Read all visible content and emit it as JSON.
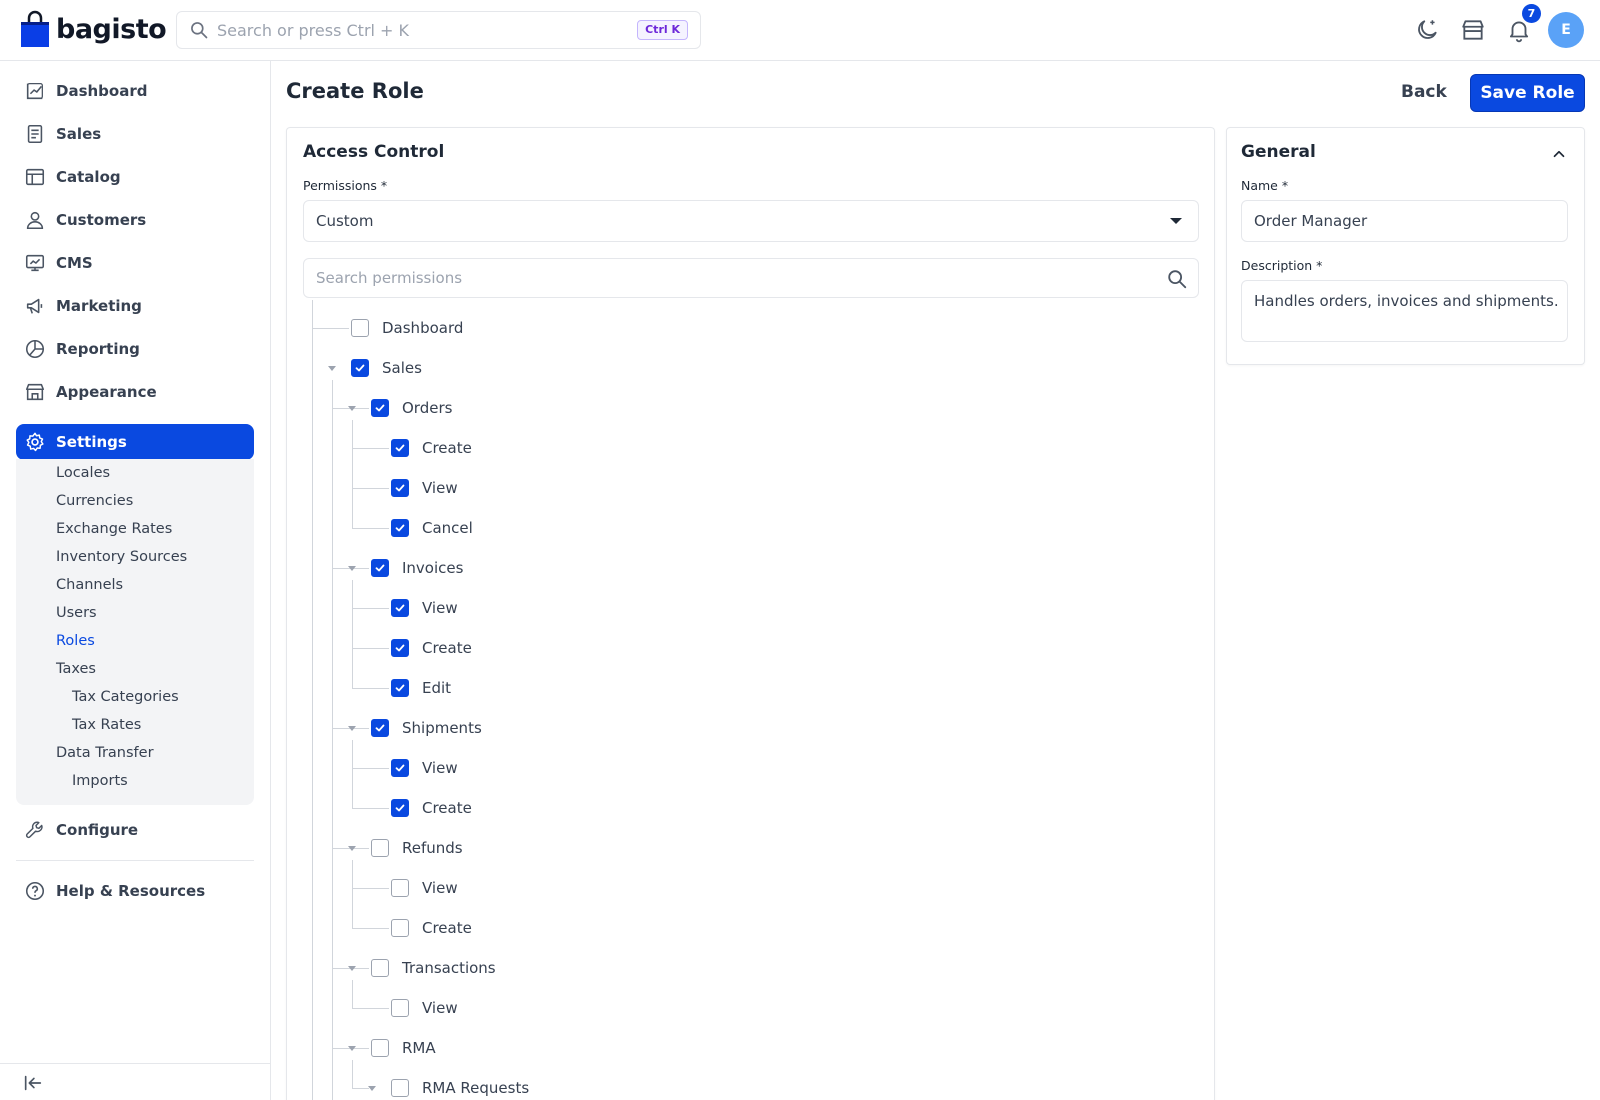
{
  "app": {
    "name": "bagisto"
  },
  "header": {
    "search_placeholder": "Search or press Ctrl + K",
    "shortcut": "Ctrl K",
    "notification_count": "7",
    "avatar_initial": "E"
  },
  "sidebar": {
    "items": [
      {
        "label": "Dashboard",
        "icon": "dashboard-icon"
      },
      {
        "label": "Sales",
        "icon": "sales-icon"
      },
      {
        "label": "Catalog",
        "icon": "catalog-icon"
      },
      {
        "label": "Customers",
        "icon": "customers-icon"
      },
      {
        "label": "CMS",
        "icon": "cms-icon"
      },
      {
        "label": "Marketing",
        "icon": "marketing-icon"
      },
      {
        "label": "Reporting",
        "icon": "reporting-icon"
      },
      {
        "label": "Appearance",
        "icon": "appearance-icon"
      },
      {
        "label": "Settings",
        "icon": "settings-icon",
        "active": true
      }
    ],
    "settings_sub": [
      "Locales",
      "Currencies",
      "Exchange Rates",
      "Inventory Sources",
      "Channels",
      "Users",
      "Roles",
      "Taxes",
      "Tax Categories",
      "Tax Rates",
      "Data Transfer",
      "Imports"
    ],
    "configure": "Configure",
    "help": "Help & Resources"
  },
  "page": {
    "title": "Create Role",
    "back": "Back",
    "save": "Save Role"
  },
  "access_control": {
    "title": "Access Control",
    "permissions_label": "Permissions *",
    "permissions_value": "Custom",
    "search_placeholder": "Search permissions",
    "tree": [
      {
        "label": "Dashboard",
        "checked": false
      },
      {
        "label": "Sales",
        "checked": true
      },
      {
        "label": "Orders",
        "checked": true
      },
      {
        "label": "Create",
        "checked": true
      },
      {
        "label": "View",
        "checked": true
      },
      {
        "label": "Cancel",
        "checked": true
      },
      {
        "label": "Invoices",
        "checked": true
      },
      {
        "label": "View",
        "checked": true
      },
      {
        "label": "Create",
        "checked": true
      },
      {
        "label": "Edit",
        "checked": true
      },
      {
        "label": "Shipments",
        "checked": true
      },
      {
        "label": "View",
        "checked": true
      },
      {
        "label": "Create",
        "checked": true
      },
      {
        "label": "Refunds",
        "checked": false
      },
      {
        "label": "View",
        "checked": false
      },
      {
        "label": "Create",
        "checked": false
      },
      {
        "label": "Transactions",
        "checked": false
      },
      {
        "label": "View",
        "checked": false
      },
      {
        "label": "RMA",
        "checked": false
      },
      {
        "label": "RMA Requests",
        "checked": false
      }
    ]
  },
  "general": {
    "title": "General",
    "name_label": "Name *",
    "name_value": "Order Manager",
    "description_label": "Description *",
    "description_value": "Handles orders, invoices and shipments."
  },
  "colors": {
    "accent": "#0a49e0",
    "avatar": "#5aa2f7"
  }
}
